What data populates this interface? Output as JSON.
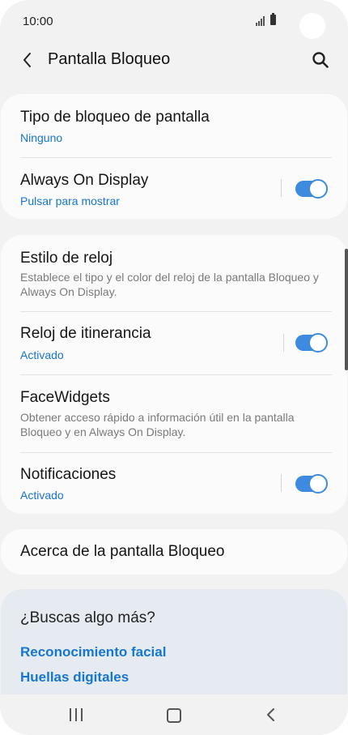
{
  "status": {
    "time": "10:00"
  },
  "header": {
    "title": "Pantalla Bloqueo",
    "back_icon": "chevron-left-icon",
    "search_icon": "search-icon"
  },
  "card1": {
    "items": [
      {
        "title": "Tipo de bloqueo de pantalla",
        "sub": "Ninguno"
      },
      {
        "title": "Always On Display",
        "sub": "Pulsar para mostrar",
        "toggle_on": true
      }
    ]
  },
  "card2": {
    "items": [
      {
        "title": "Estilo de reloj",
        "desc": "Establece el tipo y el color del reloj de la pantalla Bloqueo y Always On Display."
      },
      {
        "title": "Reloj de itinerancia",
        "sub": "Activado",
        "toggle_on": true
      },
      {
        "title": "FaceWidgets",
        "desc": "Obtener acceso rápido a información útil en la pantalla Bloqueo y en Always On Display."
      },
      {
        "title": "Notificaciones",
        "sub": "Activado",
        "toggle_on": true
      }
    ]
  },
  "card3": {
    "title": "Acerca de la pantalla Bloqueo"
  },
  "more": {
    "title": "¿Buscas algo más?",
    "links": [
      "Reconocimiento facial",
      "Huellas digitales"
    ]
  },
  "colors": {
    "accent": "#1776cf",
    "toggle": "#3e8ae0",
    "background": "#f2f2f2"
  }
}
